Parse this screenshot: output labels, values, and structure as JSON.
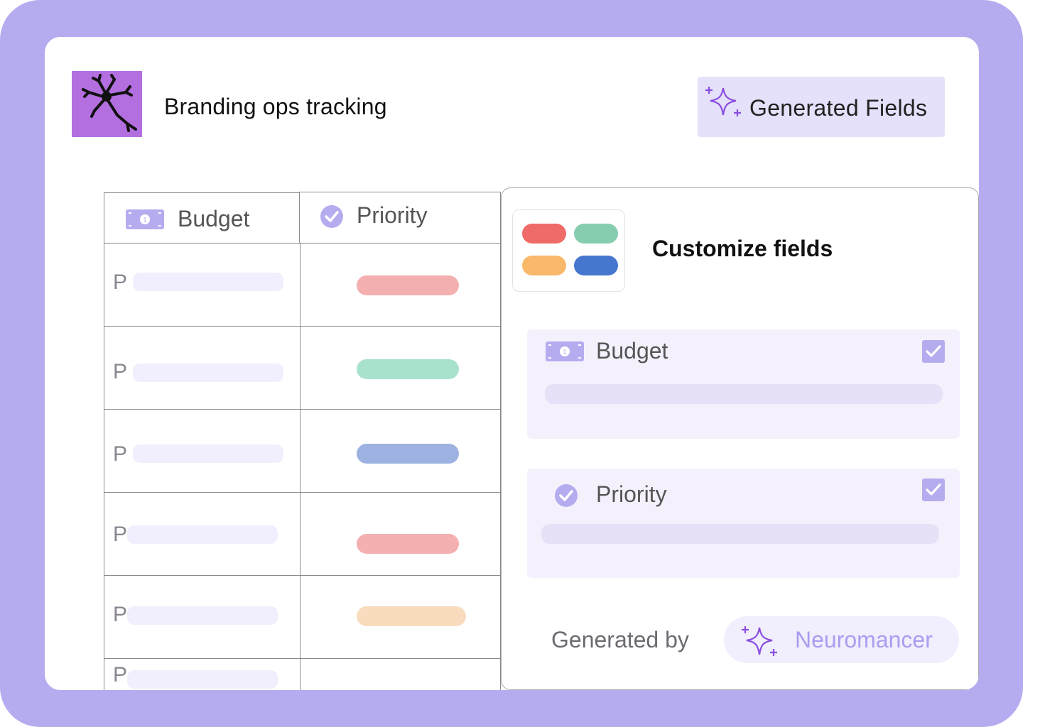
{
  "app": {
    "title": "Branding ops tracking",
    "logo_icon": "neuron-icon"
  },
  "header": {
    "generated_fields_label": "Generated Fields",
    "generated_fields_icon": "sparkle-icon"
  },
  "table": {
    "columns": [
      {
        "label": "Budget",
        "icon": "money-bill-icon"
      },
      {
        "label": "Priority",
        "icon": "check-circle-icon"
      }
    ],
    "rows": [
      {
        "budget": "P",
        "priority_color": "#f4b0b0"
      },
      {
        "budget": "P",
        "priority_color": "#a8e2cc"
      },
      {
        "budget": "P",
        "priority_color": "#9db2e0"
      },
      {
        "budget": "P",
        "priority_color": "#f4b0b0"
      },
      {
        "budget": "P",
        "priority_color": "#f8dcbd"
      },
      {
        "budget": "P",
        "priority_color": ""
      }
    ]
  },
  "panel": {
    "title": "Customize fields",
    "palette_colors": [
      "#ef6b68",
      "#86cdaf",
      "#f9b96a",
      "#4776cf"
    ],
    "fields": [
      {
        "label": "Budget",
        "icon": "money-bill-icon",
        "checked": true
      },
      {
        "label": "Priority",
        "icon": "check-circle-icon",
        "checked": true
      }
    ],
    "generated_by_label": "Generated by",
    "generator_name": "Neuromancer"
  },
  "colors": {
    "accent": "#b5acf0",
    "frame": "#b5acf0",
    "card": "#ffffff",
    "logo_bg": "#b36fe0"
  }
}
